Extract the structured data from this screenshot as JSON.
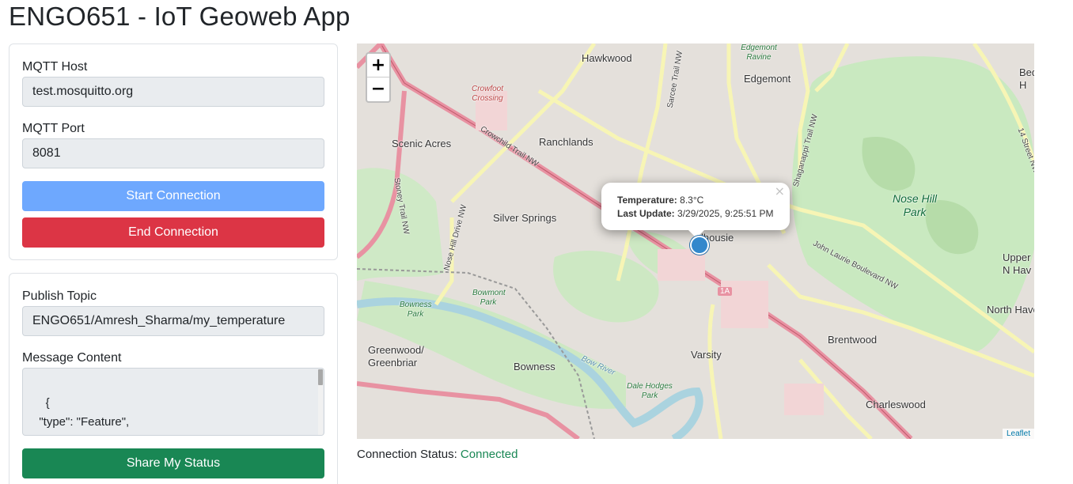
{
  "app": {
    "title": "ENGO651 - IoT Geoweb App"
  },
  "connection_panel": {
    "host_label": "MQTT Host",
    "host_value": "test.mosquitto.org",
    "port_label": "MQTT Port",
    "port_value": "8081",
    "start_label": "Start Connection",
    "end_label": "End Connection"
  },
  "publish_panel": {
    "topic_label": "Publish Topic",
    "topic_value": "ENGO651/Amresh_Sharma/my_temperature",
    "message_label": "Message Content",
    "message_value": "{\n  \"type\": \"Feature\",\n  \"properties\": {",
    "share_label": "Share My Status"
  },
  "map": {
    "zoom_in": "+",
    "zoom_out": "−",
    "popup": {
      "temp_key": "Temperature:",
      "temp_value": "8.3°C",
      "update_key": "Last Update:",
      "update_value": "3/29/2025, 9:25:51 PM",
      "close": "×"
    },
    "attribution": "Leaflet",
    "places": {
      "hawkwood": "Hawkwood",
      "edgemont": "Edgemont",
      "edgemont_ravine": "Edgemont Ravine",
      "crowfoot": "Crowfoot Crossing",
      "scenic_acres": "Scenic Acres",
      "ranchlands": "Ranchlands",
      "silver_springs": "Silver Springs",
      "nose_hill": "Nose Hill Park",
      "dalhousie": "lhousie",
      "bowness_park": "Bowness Park",
      "bowmont_park": "Bowmont Park",
      "greenwood": "Greenwood/ Greenbriar",
      "bowness": "Bowness",
      "varsity": "Varsity",
      "brentwood": "Brentwood",
      "dale_hodges": "Dale Hodges Park",
      "bow_river": "Bow River",
      "charleswood": "Charleswood",
      "north_haven": "North Have",
      "upper_haven": "Upper N Hav",
      "bed": "Bed H",
      "hwy_1a": "1A",
      "crowchild_trail": "Crowchild Trail NW",
      "sarcee_trail": "Sarcee Trail NW",
      "shaganappi_trail": "Shaganappi Trail NW",
      "john_laurie": "John Laurie Boulevard NW",
      "nose_hill_drive": "Nose Hill Drive NW",
      "stoney_trail": "Stoney Trail NW",
      "fourteen_st": "14 Street NW"
    }
  },
  "status": {
    "label": "Connection Status:",
    "value": "Connected",
    "value_color": "#198754"
  }
}
